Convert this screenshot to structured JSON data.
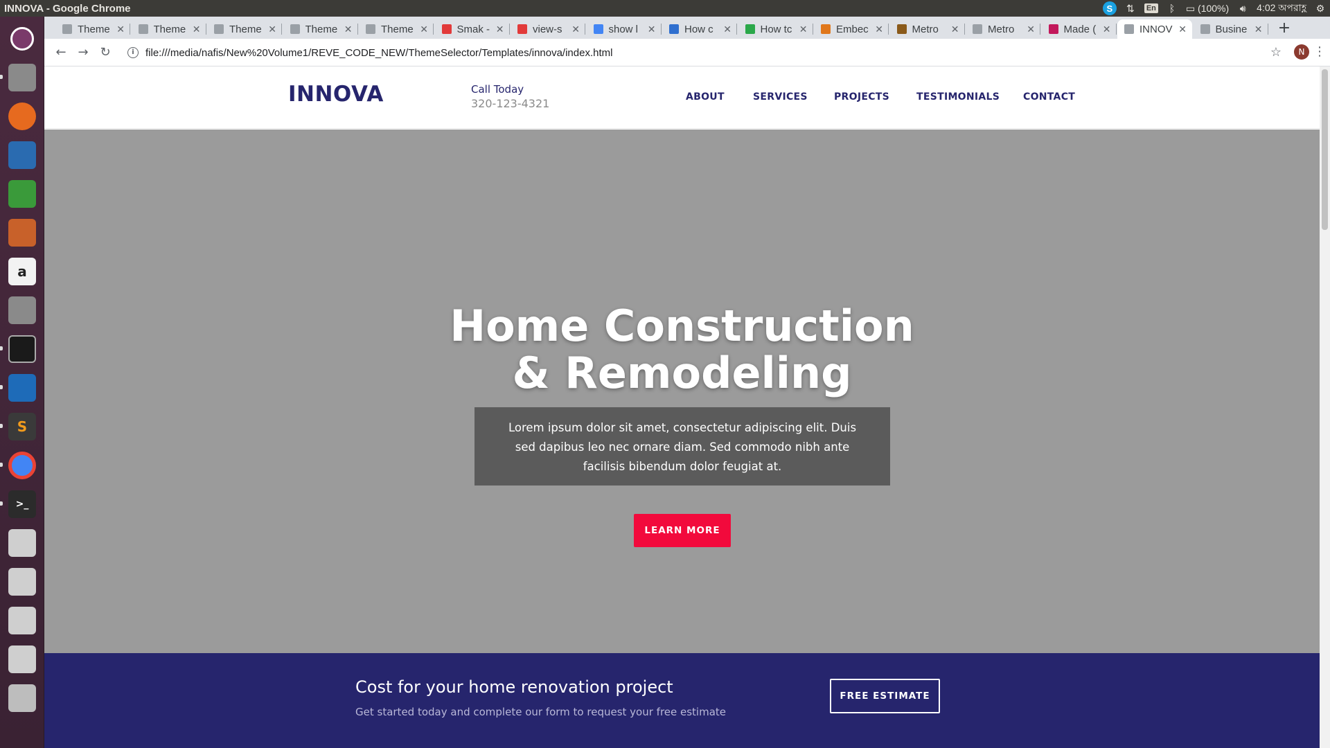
{
  "os_panel": {
    "window_title": "INNOVA - Google Chrome",
    "skype": "S",
    "lang": "En",
    "battery": "(100%)",
    "clock": "4:02 অপরাহ্ণ"
  },
  "browser": {
    "tabs": [
      {
        "label": "Theme",
        "favicon_color": "#9aa0a6"
      },
      {
        "label": "Theme",
        "favicon_color": "#9aa0a6"
      },
      {
        "label": "Theme",
        "favicon_color": "#9aa0a6"
      },
      {
        "label": "Theme",
        "favicon_color": "#9aa0a6"
      },
      {
        "label": "Theme",
        "favicon_color": "#9aa0a6"
      },
      {
        "label": "Smak -",
        "favicon_color": "#e23a3a"
      },
      {
        "label": "view-s",
        "favicon_color": "#e23a3a"
      },
      {
        "label": "show l",
        "favicon_color": "#4285f4"
      },
      {
        "label": "How c",
        "favicon_color": "#2f6fcf"
      },
      {
        "label": "How tc",
        "favicon_color": "#2ba84a"
      },
      {
        "label": "Embec",
        "favicon_color": "#e0771b"
      },
      {
        "label": "Metro",
        "favicon_color": "#8a5a1a"
      },
      {
        "label": "Metro",
        "favicon_color": "#9aa0a6"
      },
      {
        "label": "Made (",
        "favicon_color": "#c2185b"
      },
      {
        "label": "INNOV",
        "favicon_color": "#9aa0a6",
        "active": true
      },
      {
        "label": "Busine",
        "favicon_color": "#9aa0a6"
      }
    ],
    "url": "file:///media/nafis/New%20Volume1/REVE_CODE_NEW/ThemeSelector/Templates/innova/index.html",
    "profile_initial": "N"
  },
  "site": {
    "logo": "INNOVA",
    "call_label": "Call Today",
    "call_number": "320-123-4321",
    "nav": [
      "ABOUT",
      "SERVICES",
      "PROJECTS",
      "TESTIMONIALS",
      "CONTACT"
    ],
    "hero": {
      "title_line1": "Home Construction",
      "title_line2": "& Remodeling",
      "text": "Lorem ipsum dolor sit amet, consectetur adipiscing elit. Duis sed dapibus leo nec ornare diam. Sed commodo nibh ante facilisis bibendum dolor feugiat at.",
      "cta": "LEARN MORE"
    },
    "estimate": {
      "title": "Cost for your home renovation project",
      "subtitle": "Get started today and complete our form to request your free estimate",
      "cta": "FREE ESTIMATE"
    }
  },
  "colors": {
    "brand_navy": "#26256d",
    "cta_red": "#f20a3c",
    "hero_bg": "#9b9b9b"
  }
}
